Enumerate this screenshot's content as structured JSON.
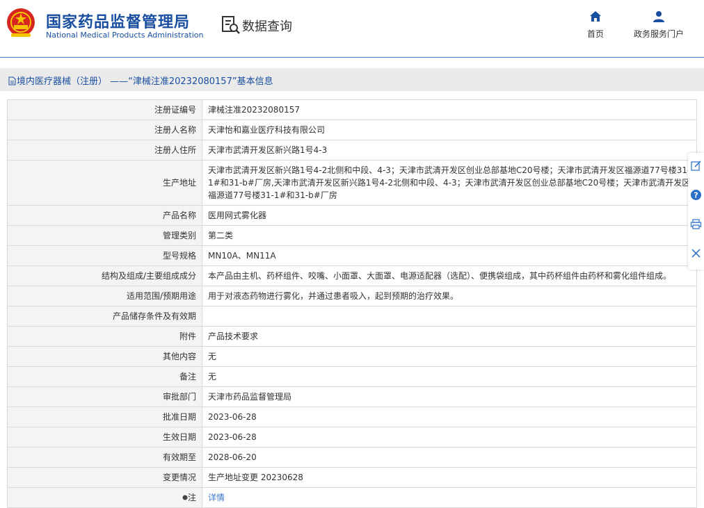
{
  "header": {
    "org_cn": "国家药品监督管理局",
    "org_en": "National Medical Products Administration",
    "query_label": "数据查询",
    "nav": [
      {
        "label": "首页",
        "icon": "home-icon"
      },
      {
        "label": "政务服务门户",
        "icon": "user-icon"
      }
    ]
  },
  "breadcrumb": "境内医疗器械（注册） ——“津械注准20232080157”基本信息",
  "colors": {
    "brand": "#1a4fa0",
    "link": "#3a78c8",
    "key_bg": "#f4f4f4"
  },
  "rows": [
    {
      "key": "注册证编号",
      "value": "津械注准20232080157"
    },
    {
      "key": "注册人名称",
      "value": "天津怡和嘉业医疗科技有限公司"
    },
    {
      "key": "注册人住所",
      "value": "天津市武清开发区新兴路1号4-3"
    },
    {
      "key": "生产地址",
      "value": "天津市武清开发区新兴路1号4-2北侧和中段、4-3；天津市武清开发区创业总部基地C20号楼；天津市武清开发区福源道77号楼31-1#和31-b#厂房,天津市武清开发区新兴路1号4-2北侧和中段、4-3；天津市武清开发区创业总部基地C20号楼；天津市武清开发区福源道77号楼31-1#和31-b#厂房"
    },
    {
      "key": "产品名称",
      "value": "医用网式雾化器"
    },
    {
      "key": "管理类别",
      "value": "第二类"
    },
    {
      "key": "型号规格",
      "value": "MN10A、MN11A"
    },
    {
      "key": "结构及组成/主要组成成分",
      "value": "本产品由主机、药杯组件、咬嘴、小面罩、大面罩、电源适配器（选配）、便携袋组成，其中药杯组件由药杯和雾化组件组成。"
    },
    {
      "key": "适用范围/预期用途",
      "value": "用于对液态药物进行雾化，并通过患者吸入，起到预期的治疗效果。"
    },
    {
      "key": "产品储存条件及有效期",
      "value": ""
    },
    {
      "key": "附件",
      "value": "产品技术要求"
    },
    {
      "key": "其他内容",
      "value": "无"
    },
    {
      "key": "备注",
      "value": "无"
    },
    {
      "key": "审批部门",
      "value": "天津市药品监督管理局"
    },
    {
      "key": "批准日期",
      "value": "2023-06-28"
    },
    {
      "key": "生效日期",
      "value": "2023-06-28"
    },
    {
      "key": "有效期至",
      "value": "2028-06-20"
    },
    {
      "key": "变更情况",
      "value": "生产地址变更 20230628"
    }
  ],
  "note": {
    "key": "注",
    "value": "详情"
  },
  "side_toolbar": [
    "edit-icon",
    "help-icon",
    "print-icon",
    "close-icon"
  ]
}
